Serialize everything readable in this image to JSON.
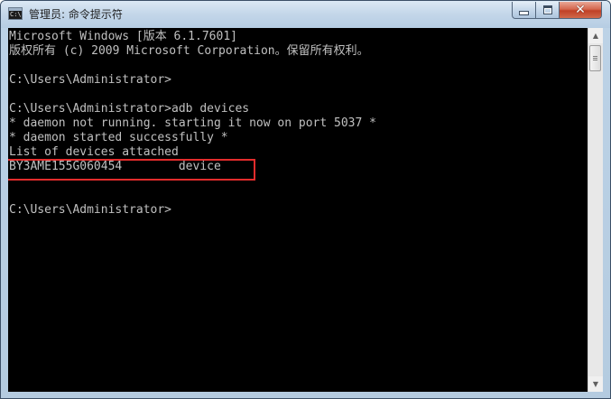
{
  "window": {
    "title": "管理员: 命令提示符",
    "icon": "cmd-icon",
    "icon_text": "C:\\"
  },
  "controls": {
    "minimize_icon": "minimize-icon",
    "maximize_icon": "maximize-icon",
    "close_icon": "close-icon",
    "close_glyph": "✕"
  },
  "console": {
    "lines": [
      "Microsoft Windows [版本 6.1.7601]",
      "版权所有 (c) 2009 Microsoft Corporation。保留所有权利。",
      "",
      "C:\\Users\\Administrator>",
      "",
      "C:\\Users\\Administrator>adb devices",
      "* daemon not running. starting it now on port 5037 *",
      "* daemon started successfully *",
      "List of devices attached",
      "BY3AME155G060454        device",
      "",
      "",
      "C:\\Users\\Administrator>"
    ]
  },
  "scrollbar": {
    "up_glyph": "▲",
    "down_glyph": "▼"
  },
  "colors": {
    "console_bg": "#000000",
    "console_text": "#c0c0c0",
    "highlight_border": "#e32c2c"
  }
}
